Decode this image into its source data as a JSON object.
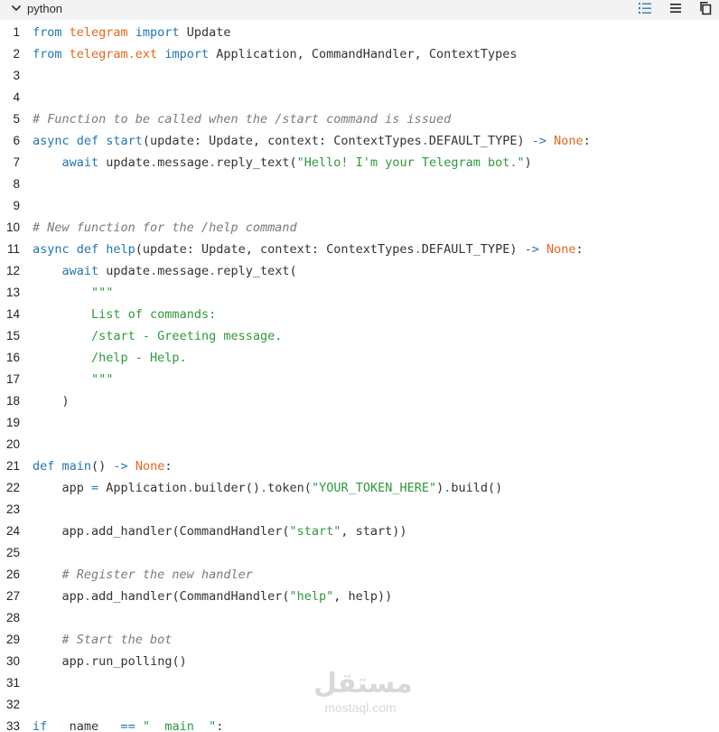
{
  "header": {
    "language": "python",
    "icons": [
      "collapse-chevron-icon",
      "numbered-list-icon",
      "wrap-lines-icon",
      "copy-icon"
    ]
  },
  "code": {
    "lines": [
      {
        "n": "1",
        "tokens": [
          [
            "kw",
            "from "
          ],
          [
            "mod",
            "telegram"
          ],
          [
            "kw",
            " import"
          ],
          [
            "pl",
            " Update"
          ]
        ]
      },
      {
        "n": "2",
        "tokens": [
          [
            "kw",
            "from "
          ],
          [
            "mod",
            "telegram.ext"
          ],
          [
            "kw",
            " import"
          ],
          [
            "pl",
            " Application, CommandHandler, ContextTypes"
          ]
        ]
      },
      {
        "n": "3",
        "tokens": []
      },
      {
        "n": "4",
        "tokens": []
      },
      {
        "n": "5",
        "tokens": [
          [
            "cm",
            "# Function to be called when the /start command is issued"
          ]
        ]
      },
      {
        "n": "6",
        "tokens": [
          [
            "kw",
            "async def "
          ],
          [
            "fn",
            "start"
          ],
          [
            "pl",
            "(update: Update, context: ContextTypes"
          ],
          [
            "op",
            "."
          ],
          [
            "pl",
            "DEFAULT_TYPE) "
          ],
          [
            "op",
            "-> "
          ],
          [
            "none",
            "None"
          ],
          [
            "pl",
            ":"
          ]
        ]
      },
      {
        "n": "7",
        "tokens": [
          [
            "pl",
            "    "
          ],
          [
            "kw",
            "await"
          ],
          [
            "pl",
            " update"
          ],
          [
            "op",
            "."
          ],
          [
            "pl",
            "message"
          ],
          [
            "op",
            "."
          ],
          [
            "pl",
            "reply_text("
          ],
          [
            "str",
            "\"Hello! I'm your Telegram bot.\""
          ],
          [
            "pl",
            ")"
          ]
        ]
      },
      {
        "n": "8",
        "tokens": []
      },
      {
        "n": "9",
        "tokens": []
      },
      {
        "n": "10",
        "tokens": [
          [
            "cm",
            "# New function for the /help command"
          ]
        ]
      },
      {
        "n": "11",
        "tokens": [
          [
            "kw",
            "async def "
          ],
          [
            "fn",
            "help"
          ],
          [
            "pl",
            "(update: Update, context: ContextTypes"
          ],
          [
            "op",
            "."
          ],
          [
            "pl",
            "DEFAULT_TYPE) "
          ],
          [
            "op",
            "-> "
          ],
          [
            "none",
            "None"
          ],
          [
            "pl",
            ":"
          ]
        ]
      },
      {
        "n": "12",
        "tokens": [
          [
            "pl",
            "    "
          ],
          [
            "kw",
            "await"
          ],
          [
            "pl",
            " update"
          ],
          [
            "op",
            "."
          ],
          [
            "pl",
            "message"
          ],
          [
            "op",
            "."
          ],
          [
            "pl",
            "reply_text("
          ]
        ]
      },
      {
        "n": "13",
        "tokens": [
          [
            "pl",
            "        "
          ],
          [
            "str",
            "\"\"\""
          ]
        ]
      },
      {
        "n": "14",
        "tokens": [
          [
            "pl",
            "        "
          ],
          [
            "str",
            "List of commands:"
          ]
        ]
      },
      {
        "n": "15",
        "tokens": [
          [
            "pl",
            "        "
          ],
          [
            "str",
            "/start - Greeting message."
          ]
        ]
      },
      {
        "n": "16",
        "tokens": [
          [
            "pl",
            "        "
          ],
          [
            "str",
            "/help - Help."
          ]
        ]
      },
      {
        "n": "17",
        "tokens": [
          [
            "pl",
            "        "
          ],
          [
            "str",
            "\"\"\""
          ]
        ]
      },
      {
        "n": "18",
        "tokens": [
          [
            "pl",
            "    )"
          ]
        ]
      },
      {
        "n": "19",
        "tokens": []
      },
      {
        "n": "20",
        "tokens": []
      },
      {
        "n": "21",
        "tokens": [
          [
            "kw",
            "def "
          ],
          [
            "fn",
            "main"
          ],
          [
            "pl",
            "() "
          ],
          [
            "op",
            "-> "
          ],
          [
            "none",
            "None"
          ],
          [
            "pl",
            ":"
          ]
        ]
      },
      {
        "n": "22",
        "tokens": [
          [
            "pl",
            "    app "
          ],
          [
            "op",
            "="
          ],
          [
            "pl",
            " Application"
          ],
          [
            "op",
            "."
          ],
          [
            "pl",
            "builder()"
          ],
          [
            "op",
            "."
          ],
          [
            "pl",
            "token("
          ],
          [
            "str",
            "\"YOUR_TOKEN_HERE\""
          ],
          [
            "pl",
            ")"
          ],
          [
            "op",
            "."
          ],
          [
            "pl",
            "build()"
          ]
        ]
      },
      {
        "n": "23",
        "tokens": []
      },
      {
        "n": "24",
        "tokens": [
          [
            "pl",
            "    app"
          ],
          [
            "op",
            "."
          ],
          [
            "pl",
            "add_handler(CommandHandler("
          ],
          [
            "str",
            "\"start\""
          ],
          [
            "pl",
            ", start))"
          ]
        ]
      },
      {
        "n": "25",
        "tokens": []
      },
      {
        "n": "26",
        "tokens": [
          [
            "pl",
            "    "
          ],
          [
            "cm",
            "# Register the new handler"
          ]
        ]
      },
      {
        "n": "27",
        "tokens": [
          [
            "pl",
            "    app"
          ],
          [
            "op",
            "."
          ],
          [
            "pl",
            "add_handler(CommandHandler("
          ],
          [
            "str",
            "\"help\""
          ],
          [
            "pl",
            ", help))"
          ]
        ]
      },
      {
        "n": "28",
        "tokens": []
      },
      {
        "n": "29",
        "tokens": [
          [
            "pl",
            "    "
          ],
          [
            "cm",
            "# Start the bot"
          ]
        ]
      },
      {
        "n": "30",
        "tokens": [
          [
            "pl",
            "    app"
          ],
          [
            "op",
            "."
          ],
          [
            "pl",
            "run_polling()"
          ]
        ]
      },
      {
        "n": "31",
        "tokens": []
      },
      {
        "n": "32",
        "tokens": []
      },
      {
        "n": "33",
        "tokens": [
          [
            "kw",
            "if"
          ],
          [
            "pl",
            " __name__ "
          ],
          [
            "op",
            "=="
          ],
          [
            "pl",
            " "
          ],
          [
            "str",
            "\"__main__\""
          ],
          [
            "pl",
            ":"
          ]
        ]
      }
    ]
  },
  "watermark": {
    "arabic": "مستقل",
    "latin": "mostaql.com"
  },
  "colors": {
    "keyword": "#1f77b4",
    "module": "#e8661c",
    "comment": "#7b7b7b",
    "string": "#2e9a3a",
    "header_bg": "#f3f3f3"
  }
}
